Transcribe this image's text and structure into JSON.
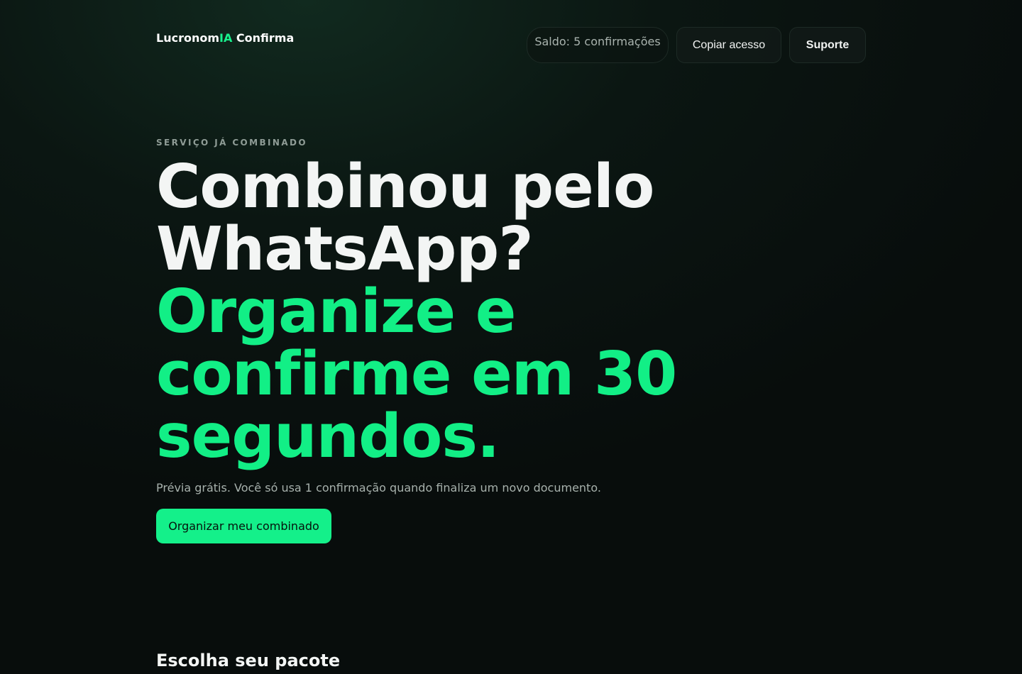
{
  "header": {
    "brand_prefix": "Lucronom",
    "brand_accent": "IA",
    "brand_suffix": " Confirma",
    "balance": "Saldo: 5 confirmações",
    "copy_access": "Copiar acesso",
    "support": "Suporte"
  },
  "hero": {
    "eyebrow": "SERVIÇO JÁ COMBINADO",
    "headline_white": "Combinou pelo WhatsApp?",
    "headline_green": "Organize e confirme em 30 segundos.",
    "subtext": "Prévia grátis. Você só usa 1 confirmação quando finaliza um novo documento.",
    "cta": "Organizar meu combinado"
  },
  "packages": {
    "title": "Escolha seu pacote"
  },
  "colors": {
    "accent": "#14f08a",
    "background": "#0b1612"
  }
}
